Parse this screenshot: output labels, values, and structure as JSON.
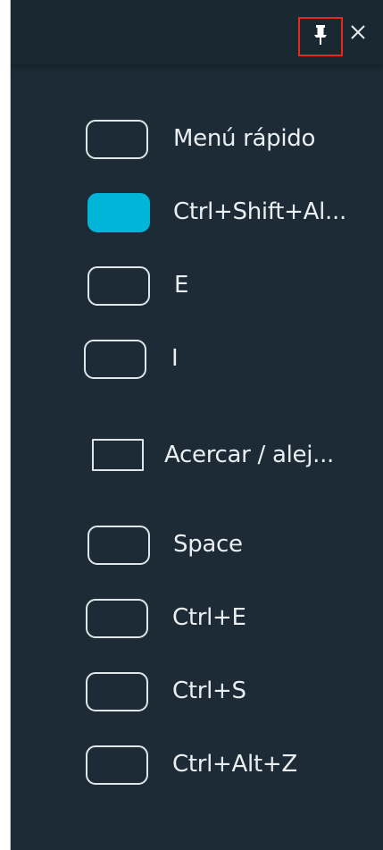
{
  "panel": {
    "header": {
      "pin_icon": "pin-icon",
      "close_icon": "close-icon",
      "highlight_color": "#e8281e"
    },
    "accent_color": "#00b5d8",
    "items": [
      {
        "label": "Menú rápido",
        "state": "off"
      },
      {
        "label": "Ctrl+Shift+Al...",
        "state": "on"
      },
      {
        "label": "E",
        "state": "off"
      },
      {
        "label": "I",
        "state": "off"
      },
      {
        "label": "Acercar / alej...",
        "state": "off"
      },
      {
        "label": "Space",
        "state": "off"
      },
      {
        "label": "Ctrl+E",
        "state": "off"
      },
      {
        "label": "Ctrl+S",
        "state": "off"
      },
      {
        "label": "Ctrl+Alt+Z",
        "state": "off"
      }
    ]
  }
}
